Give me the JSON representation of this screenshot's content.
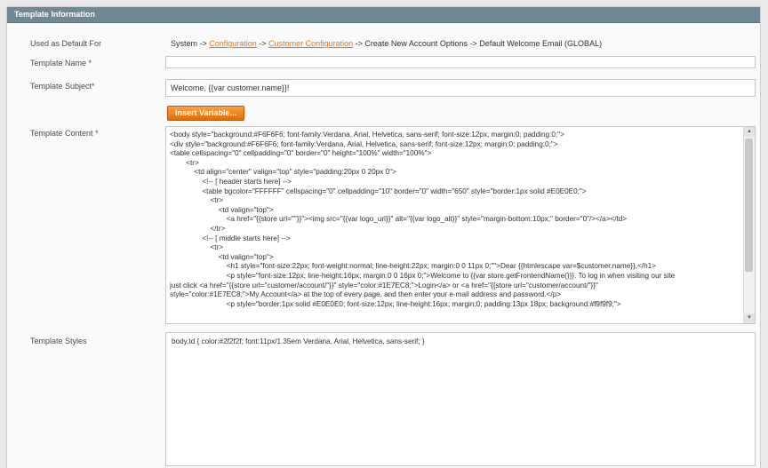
{
  "header": {
    "title": "Template Information"
  },
  "fields": {
    "default_for": {
      "label": "Used as Default For",
      "path_start": "System -> ",
      "link1": "Configuration",
      "sep1": " -> ",
      "link2": "Customer Configuration",
      "path_end": " -> Create New Account Options -> Default Welcome Email  (GLOBAL)"
    },
    "template_name": {
      "label": "Template Name",
      "required": "*",
      "value": ""
    },
    "template_subject": {
      "label": "Template Subject",
      "required": "*",
      "value": "Welcome, {{var customer.name}}!"
    },
    "insert_variable": {
      "label": "Insert Variable..."
    },
    "template_content": {
      "label": "Template Content",
      "required": "*",
      "lines": [
        "<body style=\"background:#F6F6F6; font-family:Verdana, Arial, Helvetica, sans-serif; font-size:12px; margin:0; padding:0;\">",
        "<div style=\"background:#F6F6F6; font-family:Verdana, Arial, Helvetica, sans-serif; font-size:12px; margin:0; padding:0;\">",
        "<table cellspacing=\"0\" cellpadding=\"0\" border=\"0\" height=\"100%\" width=\"100%\">",
        "        <tr>",
        "            <td align=\"center\" valign=\"top\" style=\"padding:20px 0 20px 0\">",
        "                <!-- [ header starts here] -->",
        "                <table bgcolor=\"FFFFFF\" cellspacing=\"0\" cellpadding=\"10\" border=\"0\" width=\"650\" style=\"border:1px solid #E0E0E0;\">",
        "                    <tr>",
        "                        <td valign=\"top\">",
        "                            <a href=\"{{store url=\"\"}}\"><img src=\"{{var logo_url}}\" alt=\"{{var logo_alt}}\" style=\"margin-bottom:10px;\" border=\"0\"/></a></td>",
        "                    </tr>",
        "                <!-- [ middle starts here] -->",
        "                    <tr>",
        "                        <td valign=\"top\">",
        "                            <h1 style=\"font-size:22px; font-weight:normal; line-height:22px; margin:0 0 11px 0;\"\">Dear {{htmlescape var=$customer.name}},</h1>",
        "                            <p style=\"font-size:12px; line-height:16px; margin:0 0 16px 0;\">Welcome to {{var store.getFrontendName()}}. To log in when visiting our site",
        "just click <a href=\"{{store url=\"customer/account/\"}}\" style=\"color:#1E7EC8;\">Login</a> or <a href=\"{{store url=\"customer/account/\"}}\"",
        "style=\"color:#1E7EC8;\">My Account</a> at the top of every page, and then enter your e-mail address and password.</p>",
        "                            <p style=\"border:1px solid #E0E0E0; font-size:12px; line-height:16px; margin:0; padding:13px 18px; background:#f9f9f9;\">"
      ]
    },
    "template_styles": {
      "label": "Template Styles",
      "value": "body,td { color:#2f2f2f; font:11px/1.35em Verdana, Arial, Helvetica, sans-serif; }"
    }
  }
}
